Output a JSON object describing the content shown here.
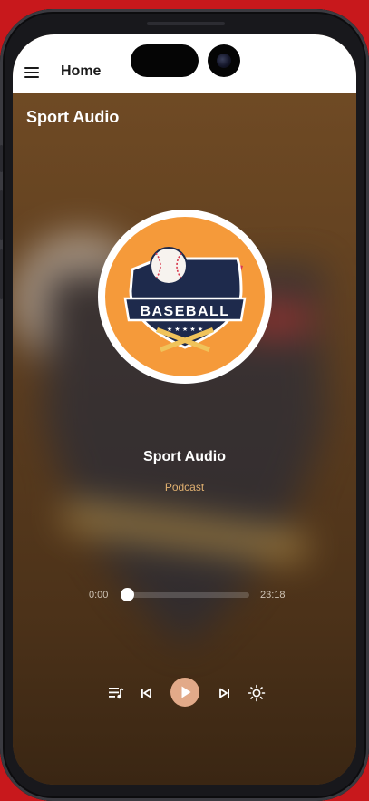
{
  "app_bar": {
    "title": "Home"
  },
  "section": {
    "title": "Sport Audio"
  },
  "artwork": {
    "badge_text": "BASEBALL",
    "accent_color": "#f59a3a"
  },
  "track": {
    "title": "Sport Audio",
    "subtitle": "Podcast"
  },
  "player": {
    "elapsed": "0:00",
    "total": "23:18",
    "progress": 0,
    "state": "paused"
  },
  "controls": [
    {
      "name": "playlist-button",
      "icon": "playlist-icon"
    },
    {
      "name": "previous-button",
      "icon": "skip-previous-icon"
    },
    {
      "name": "play-button",
      "icon": "play-icon"
    },
    {
      "name": "next-button",
      "icon": "skip-next-icon"
    },
    {
      "name": "brightness-button",
      "icon": "brightness-icon"
    }
  ],
  "colors": {
    "accent": "#e2aa89",
    "subtitle": "#e0b070",
    "background": "#5c3d1f",
    "device_background": "#c8181c"
  }
}
